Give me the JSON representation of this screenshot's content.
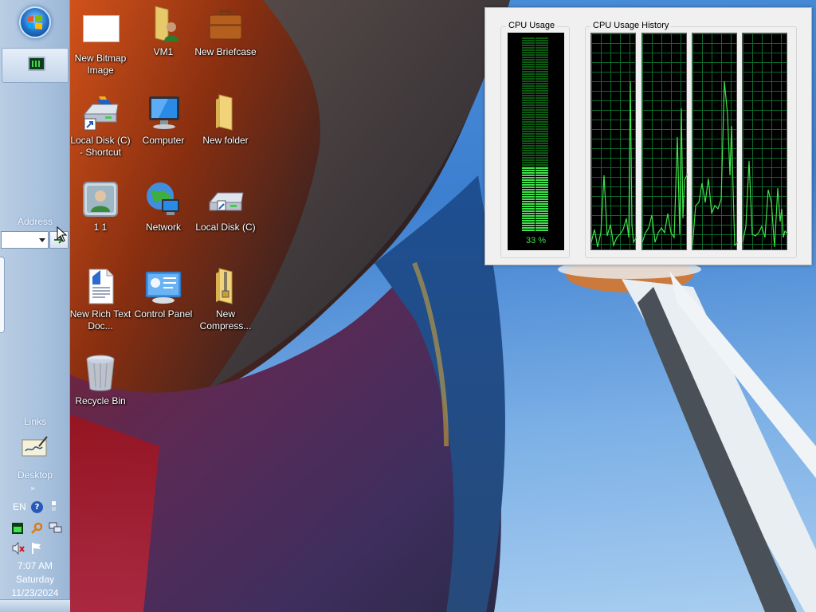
{
  "taskbar": {
    "address_label": "Address",
    "address_value": "",
    "links_label": "Links",
    "desktop_label": "Desktop",
    "language": "EN",
    "clock": {
      "time": "7:07 AM",
      "day": "Saturday",
      "date": "11/23/2024"
    }
  },
  "desktop_icons": [
    {
      "label": "New Bitmap Image"
    },
    {
      "label": "VM1"
    },
    {
      "label": "New Briefcase"
    },
    {
      "label": "Local Disk (C) - Shortcut"
    },
    {
      "label": "Computer"
    },
    {
      "label": "New folder"
    },
    {
      "label": "1 1"
    },
    {
      "label": "Network"
    },
    {
      "label": "Local Disk (C)"
    },
    {
      "label": "New Rich Text Doc..."
    },
    {
      "label": "Control Panel"
    },
    {
      "label": "New Compress..."
    },
    {
      "label": "Recycle Bin"
    }
  ],
  "cpu_widget": {
    "usage_title": "CPU Usage",
    "history_title": "CPU Usage History",
    "usage_percent": 33,
    "usage_text": "33 %",
    "cores": 4
  },
  "colors": {
    "meter_green": "#3fe24a",
    "grid_green": "#0b6a2a"
  }
}
